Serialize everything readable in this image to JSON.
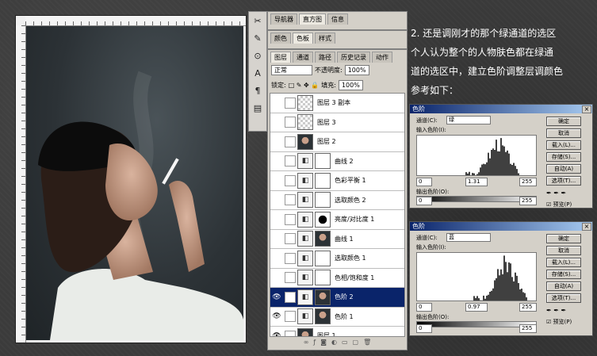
{
  "layers_panel": {
    "tabs_row1": [
      "导航器",
      "直方图",
      "信息"
    ],
    "tabs_row2": [
      "颜色",
      "色板",
      "样式"
    ],
    "tabs_row3": [
      "图层",
      "通道",
      "路径",
      "历史记录",
      "动作"
    ],
    "blend_mode": "正常",
    "opacity_label": "不透明度:",
    "opacity_value": "100%",
    "lock_label": "锁定:",
    "fill_label": "填充:",
    "fill_value": "100%",
    "layers": [
      {
        "name": "图层 3 副本",
        "visible": false,
        "thumb": "checker",
        "mask": false,
        "selected": false
      },
      {
        "name": "图层 3",
        "visible": false,
        "thumb": "checker",
        "mask": false,
        "selected": false
      },
      {
        "name": "图层 2",
        "visible": false,
        "thumb": "photo",
        "mask": false,
        "selected": false
      },
      {
        "name": "曲线 2",
        "visible": false,
        "thumb": "adj",
        "mask": true,
        "selected": false
      },
      {
        "name": "色彩平衡 1",
        "visible": false,
        "thumb": "adj",
        "mask": true,
        "selected": false
      },
      {
        "name": "选取颜色 2",
        "visible": false,
        "thumb": "adj",
        "mask": true,
        "selected": false
      },
      {
        "name": "亮度/对比度 1",
        "visible": false,
        "thumb": "adj",
        "mask": "dark",
        "selected": false
      },
      {
        "name": "曲线 1",
        "visible": false,
        "thumb": "adj",
        "mask": "photo",
        "selected": false
      },
      {
        "name": "选取颜色 1",
        "visible": false,
        "thumb": "adj",
        "mask": true,
        "selected": false
      },
      {
        "name": "色相/饱和度 1",
        "visible": false,
        "thumb": "adj",
        "mask": true,
        "selected": false
      },
      {
        "name": "色阶 2",
        "visible": true,
        "thumb": "adj",
        "mask": "photo",
        "selected": true
      },
      {
        "name": "色阶 1",
        "visible": true,
        "thumb": "adj",
        "mask": "photo",
        "selected": false
      },
      {
        "name": "图层 1",
        "visible": true,
        "thumb": "photo",
        "mask": false,
        "selected": false
      }
    ]
  },
  "note": {
    "lines": [
      "2. 还是调刚才的那个绿通道的选区",
      "个人认为整个的人物肤色都在绿通",
      "道的选区中，建立色阶调整层调颜色",
      "参考如下："
    ]
  },
  "dialogs": [
    {
      "title": "色阶",
      "channel_label": "通道(C):",
      "channel_value": "绿",
      "input_label": "输入色阶(I):",
      "input_values": [
        "0",
        "1.31",
        "255"
      ],
      "output_label": "输出色阶(O):",
      "output_values": [
        "0",
        "255"
      ],
      "buttons": [
        "确定",
        "取消",
        "载入(L)...",
        "存储(S)...",
        "自动(A)",
        "选项(T)..."
      ],
      "preview_label": "预览(P)"
    },
    {
      "title": "色阶",
      "channel_label": "通道(C):",
      "channel_value": "蓝",
      "input_label": "输入色阶(I):",
      "input_values": [
        "0",
        "0.97",
        "255"
      ],
      "output_label": "输出色阶(O):",
      "output_values": [
        "0",
        "255"
      ],
      "buttons": [
        "确定",
        "取消",
        "载入(L)...",
        "存储(S)...",
        "自动(A)",
        "选项(T)..."
      ],
      "preview_label": "预览(P)"
    }
  ],
  "colors": {
    "selected_layer": "#0a246a",
    "panel": "#d4d0c8",
    "background": "#3b3b3b"
  }
}
